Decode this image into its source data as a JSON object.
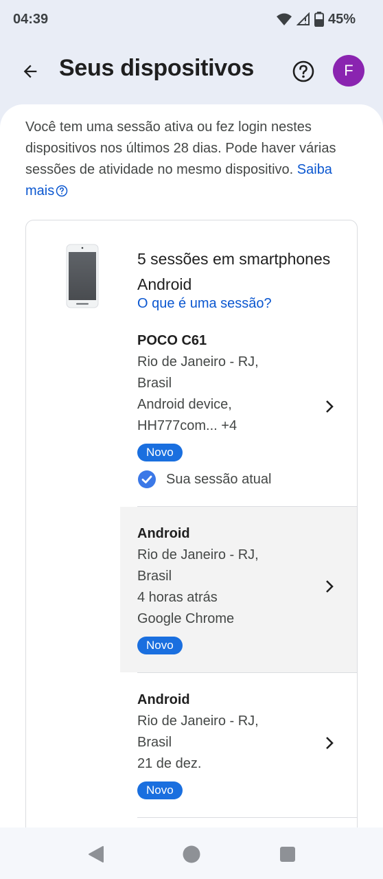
{
  "status_bar": {
    "time": "04:39",
    "battery": "45%",
    "icons": [
      "wifi-icon",
      "signal-icon",
      "battery-icon"
    ]
  },
  "app_bar": {
    "title": "Seus dispositivos",
    "avatar_letter": "F",
    "avatar_color": "#8a24b0"
  },
  "intro": {
    "text": "Você tem uma sessão ativa ou fez login nestes dispositivos nos últimos 28 dias. Pode haver várias sessões de atividade no mesmo dispositivo.",
    "learn_more": "Saiba mais"
  },
  "card": {
    "heading": "5 sessões em smartphones Android",
    "what_is_session": "O que é uma sessão?",
    "sessions": [
      {
        "name": "POCO C61",
        "lines": [
          "Rio de Janeiro - RJ,",
          "Brasil",
          "Android device,",
          "HH777com... +4"
        ],
        "badge": "Novo",
        "current_label": "Sua sessão atual"
      },
      {
        "name": "Android",
        "lines": [
          "Rio de Janeiro - RJ,",
          "Brasil",
          "4 horas atrás",
          "Google Chrome"
        ],
        "badge": "Novo"
      },
      {
        "name": "Android",
        "lines": [
          "Rio de Janeiro - RJ,",
          "Brasil",
          "21 de dez."
        ],
        "badge": "Novo"
      }
    ]
  },
  "colors": {
    "accent": "#0b57d0",
    "badge": "#1a6fdf",
    "background": "#e9edf6"
  }
}
